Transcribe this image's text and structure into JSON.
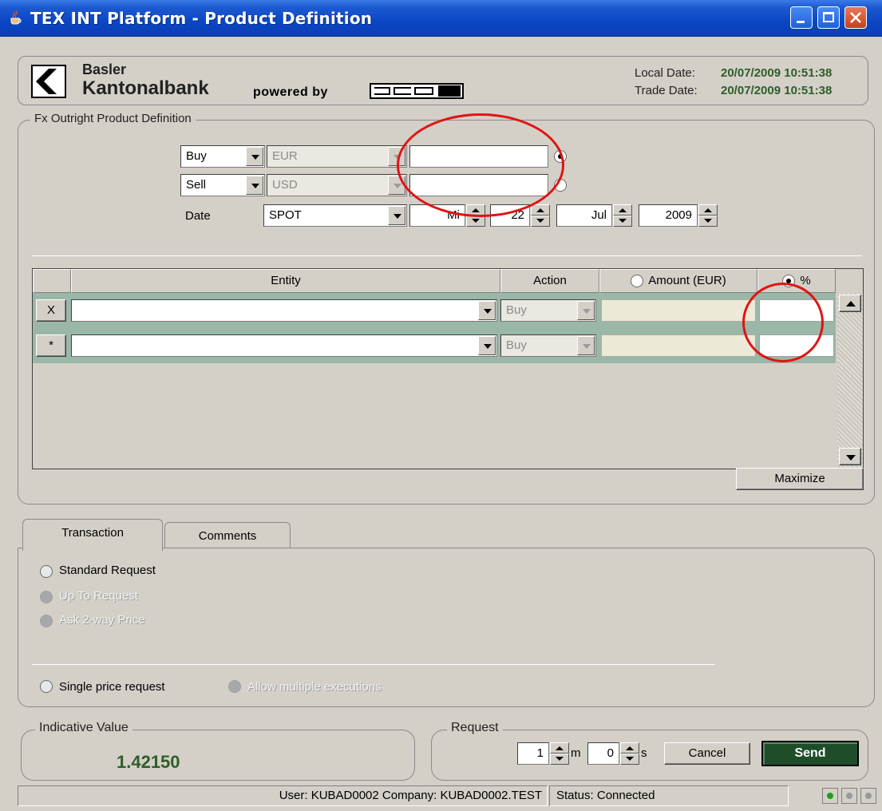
{
  "window": {
    "title": "TEX INT Platform - Product Definition"
  },
  "header": {
    "logo_line1": "Basler",
    "logo_line2": "Kantonalbank",
    "powered_by": "powered by",
    "logo360": "360T",
    "local_date_label": "Local Date:",
    "local_date_value": "20/07/2009 10:51:38",
    "trade_date_label": "Trade Date:",
    "trade_date_value": "20/07/2009 10:51:38"
  },
  "product": {
    "legend": "Fx Outright Product Definition",
    "leg1": {
      "side": "Buy",
      "currency": "EUR",
      "amount": "",
      "radio_selected": true
    },
    "leg2": {
      "side": "Sell",
      "currency": "USD",
      "amount": "",
      "radio_selected": false
    },
    "date_label": "Date",
    "tenor": "SPOT",
    "weekday": "Mi",
    "day": "22",
    "month": "Jul",
    "year": "2009"
  },
  "grid": {
    "columns": [
      "Entity",
      "Action",
      "Amount (EUR)",
      "%"
    ],
    "amount_radio_selected": false,
    "percent_radio_selected": true,
    "rows": [
      {
        "marker": "X",
        "entity": "",
        "action": "Buy",
        "amount": "",
        "percent": ""
      },
      {
        "marker": "*",
        "entity": "",
        "action": "Buy",
        "amount": "",
        "percent": ""
      }
    ],
    "maximize_label": "Maximize"
  },
  "tabs": {
    "items": [
      "Transaction",
      "Comments"
    ],
    "active": "Transaction"
  },
  "transaction": {
    "standard_request": "Standard Request",
    "up_to_request": "Up To Request",
    "ask_two_way": "Ask 2-way Price",
    "single_price": "Single price request",
    "allow_multiple": "Allow multiple executions"
  },
  "indicative": {
    "legend": "Indicative Value",
    "value": "1.42150"
  },
  "request": {
    "legend": "Request",
    "minutes": "1",
    "minutes_unit": "m",
    "seconds": "0",
    "seconds_unit": "s",
    "cancel_label": "Cancel",
    "send_label": "Send"
  },
  "statusbar": {
    "user_text": "User: KUBAD0002 Company: KUBAD0002.TEST",
    "status_text": "Status:  Connected"
  },
  "colors": {
    "titlebar": "#0a46c4",
    "send_button": "#1f4d2a",
    "indicative_value": "#2e5d2a",
    "grid_row": "#9ab7a7",
    "annotation": "#e01414"
  }
}
